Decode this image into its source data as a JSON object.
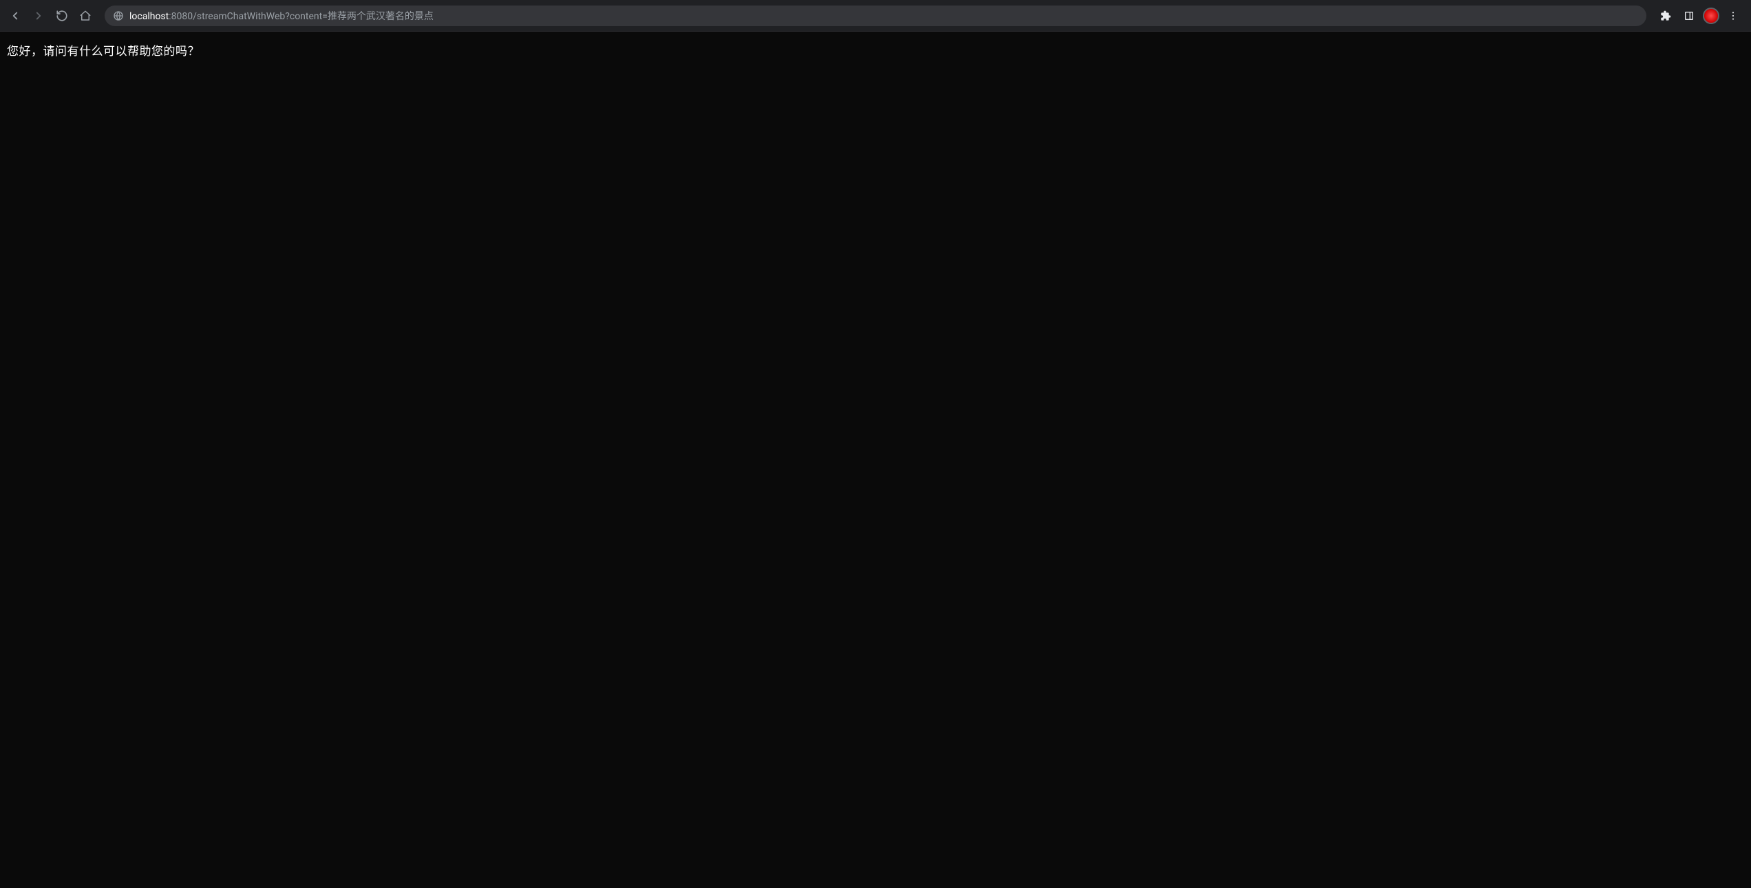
{
  "address": {
    "host": "localhost",
    "port_path": ":8080/streamChatWithWeb?content=推荐两个武汉著名的景点"
  },
  "page": {
    "response_text": "您好，请问有什么可以帮助您的吗？"
  }
}
